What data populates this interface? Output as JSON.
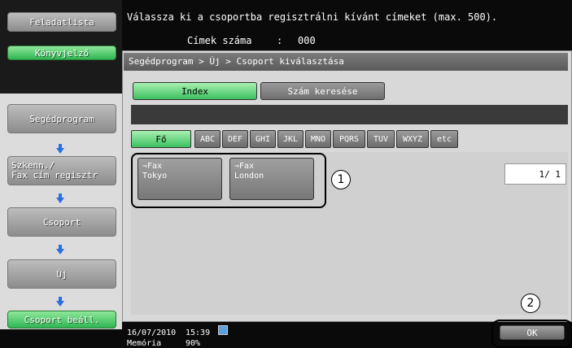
{
  "sidebar": {
    "job_list": "Feladatlista",
    "bookmark": "Könyvjelző",
    "steps": [
      "Segédprogram",
      "Szkenn./\nFax cím regisztr",
      "Csoport",
      "Új",
      "Csoport beáll."
    ]
  },
  "header": {
    "message": "Válassza ki a csoportba regisztrálni kívánt címeket (max. 500).",
    "count_label": "Címek száma",
    "count_sep": ":",
    "count_value": "000"
  },
  "breadcrumb": "Segédprogram > Új > Csoport kiválasztása",
  "tabs": [
    "Index",
    "Szám keresése"
  ],
  "index_keys": [
    "Fő",
    "ABC",
    "DEF",
    "GHI",
    "JKL",
    "MNO",
    "PQRS",
    "TUV",
    "WXYZ",
    "etc"
  ],
  "destinations": [
    {
      "type": "Fax",
      "name": "Tokyo"
    },
    {
      "type": "Fax",
      "name": "London"
    }
  ],
  "page_indicator": "1/  1",
  "callouts": [
    "1",
    "2"
  ],
  "status": {
    "date": "16/07/2010",
    "time": "15:39",
    "memory_label": "Memória",
    "memory_value": "90%"
  },
  "ok_label": "OK",
  "colors": {
    "accent_green": "#3cc060",
    "arrow_blue": "#2a6fe0"
  }
}
